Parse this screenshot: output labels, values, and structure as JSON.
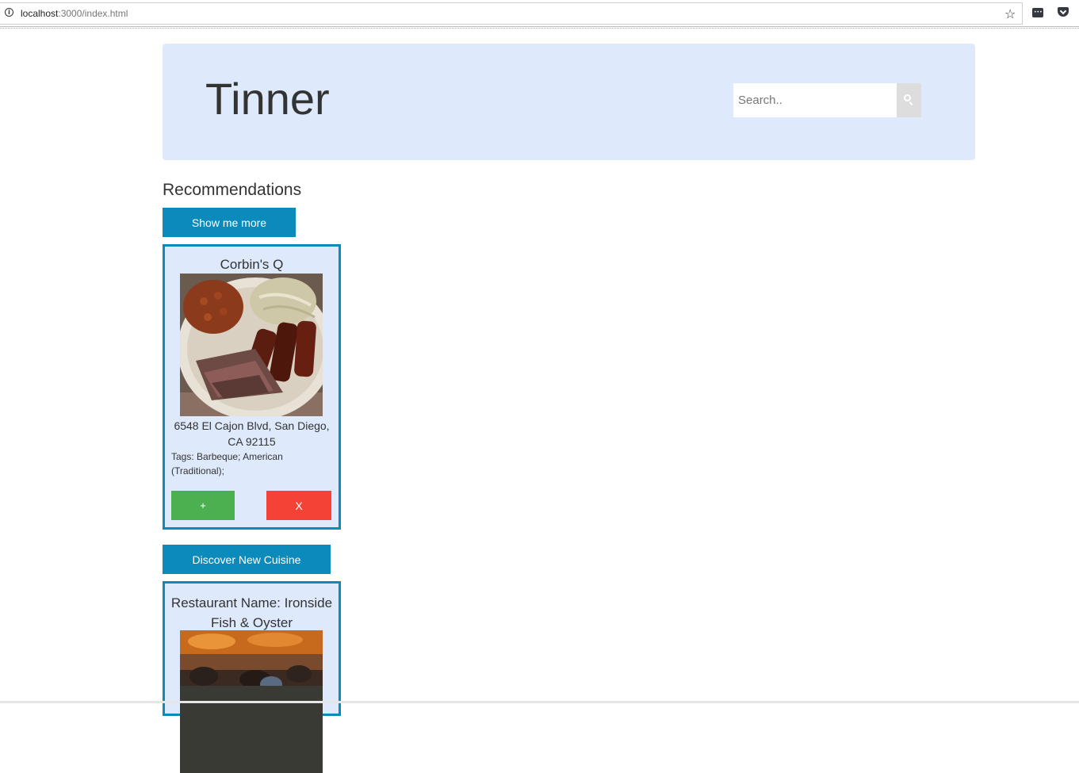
{
  "browser": {
    "url_host": "localhost",
    "url_rest": ":3000/index.html"
  },
  "header": {
    "title": "Tinner",
    "search_placeholder": "Search.."
  },
  "recommendations": {
    "heading": "Recommendations",
    "show_more_label": "Show me more",
    "card": {
      "name": "Corbin's Q",
      "address": "6548 El Cajon Blvd, San Diego, CA 92115",
      "tags": "Tags: Barbeque; American (Traditional);",
      "like_label": "+",
      "dislike_label": "X"
    }
  },
  "discover": {
    "button_label": "Discover New Cuisine",
    "card": {
      "name": "Restaurant Name: Ironside Fish & Oyster"
    }
  },
  "colors": {
    "accent": "#0b8bbc",
    "panel": "#deeafc",
    "like": "#4caf50",
    "dislike": "#f44336"
  }
}
